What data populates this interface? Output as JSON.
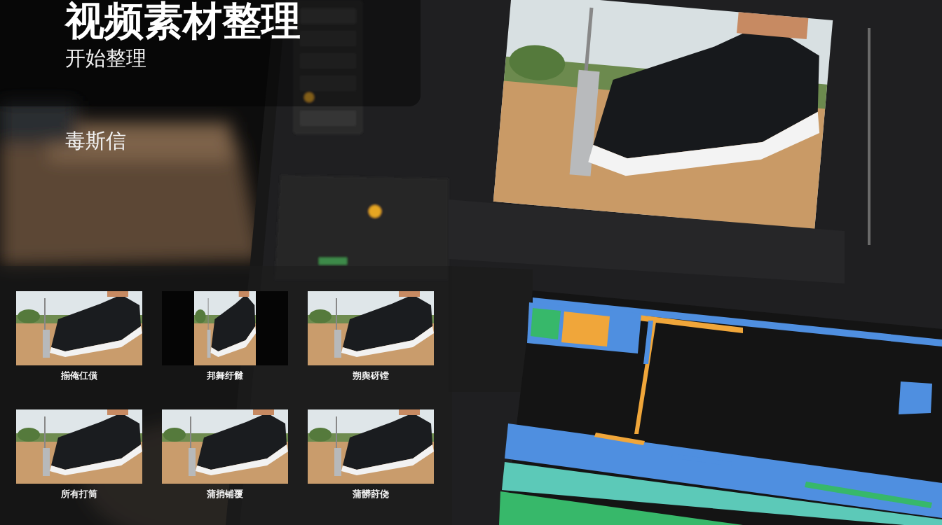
{
  "header": {
    "title": "视频素材整理",
    "subtitle": "开始整理"
  },
  "tagline": "毒斯信",
  "thumbnails": [
    {
      "caption": "揃俺仜僙",
      "letterboxed": false
    },
    {
      "caption": "邦舞纡雠",
      "letterboxed": true
    },
    {
      "caption": "朔舆砑镗",
      "letterboxed": false
    },
    {
      "caption": "所有打筒",
      "letterboxed": false
    },
    {
      "caption": "蒲捎铺覆",
      "letterboxed": false
    },
    {
      "caption": "蒲髒莳侥",
      "letterboxed": false
    }
  ]
}
